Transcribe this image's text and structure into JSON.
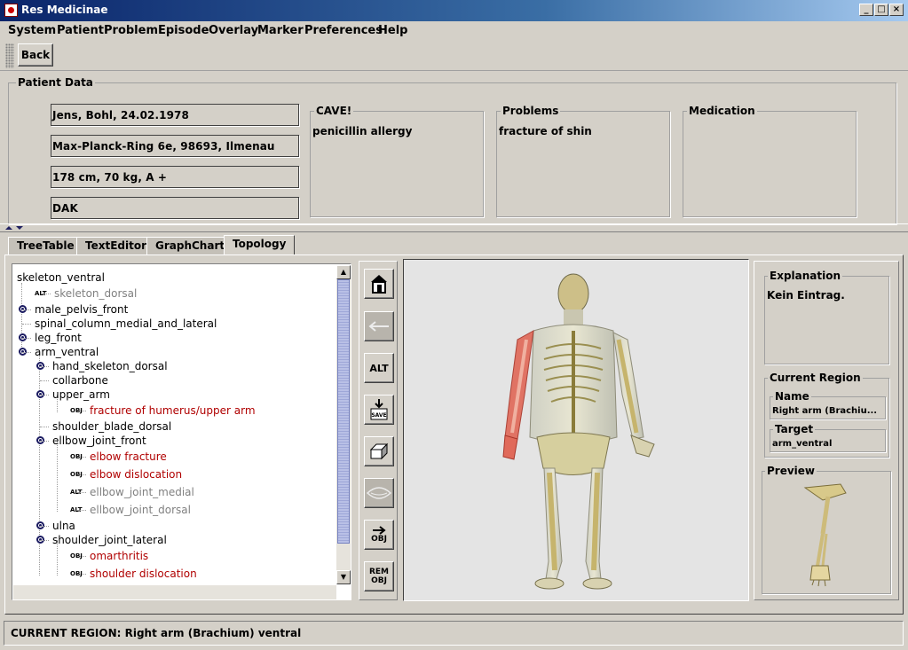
{
  "window": {
    "title": "Res Medicinae",
    "min": "_",
    "max": "□",
    "close": "×"
  },
  "menu": [
    "System",
    "Patient",
    "Problem",
    "Episode",
    "Overlay",
    "Marker",
    "Preferences",
    "Help"
  ],
  "toolbar": {
    "back_label": "Back"
  },
  "patient": {
    "group_title": "Patient Data",
    "fields": [
      "Jens, Bohl, 24.02.1978",
      "Max-Planck-Ring 6e, 98693, Ilmenau",
      "178 cm, 70 kg, A +",
      "DAK"
    ],
    "cave": {
      "title": "CAVE!",
      "text": "penicillin allergy"
    },
    "problems": {
      "title": "Problems",
      "text": "fracture of shin"
    },
    "medication": {
      "title": "Medication",
      "text": ""
    }
  },
  "tabs": [
    "TreeTable",
    "TextEditor",
    "GraphChart",
    "Topology"
  ],
  "active_tab": "Topology",
  "tree": [
    {
      "text": "skeleton_ventral",
      "kind": "node"
    },
    {
      "text": "skeleton_dorsal",
      "kind": "alt",
      "tag": "ALT"
    },
    {
      "text": "male_pelvis_front",
      "kind": "node"
    },
    {
      "text": "spinal_column_medial_and_lateral",
      "kind": "node"
    },
    {
      "text": "leg_front",
      "kind": "node"
    },
    {
      "text": "arm_ventral",
      "kind": "node"
    },
    {
      "text": "hand_skeleton_dorsal",
      "kind": "node"
    },
    {
      "text": "collarbone",
      "kind": "node"
    },
    {
      "text": "upper_arm",
      "kind": "node"
    },
    {
      "text": "fracture of humerus/upper arm",
      "kind": "obj",
      "tag": "OBJ"
    },
    {
      "text": "shoulder_blade_dorsal",
      "kind": "node"
    },
    {
      "text": "ellbow_joint_front",
      "kind": "node"
    },
    {
      "text": "elbow fracture",
      "kind": "obj",
      "tag": "OBJ"
    },
    {
      "text": "elbow dislocation",
      "kind": "obj",
      "tag": "OBJ"
    },
    {
      "text": "ellbow_joint_medial",
      "kind": "alt",
      "tag": "ALT"
    },
    {
      "text": "ellbow_joint_dorsal",
      "kind": "alt",
      "tag": "ALT"
    },
    {
      "text": "ulna",
      "kind": "node"
    },
    {
      "text": "shoulder_joint_lateral",
      "kind": "node"
    },
    {
      "text": "omarthritis",
      "kind": "obj",
      "tag": "OBJ"
    },
    {
      "text": "shoulder dislocation",
      "kind": "obj",
      "tag": "OBJ"
    }
  ],
  "tools": {
    "alt": "ALT",
    "save": "SAVE",
    "obj": "OBJ",
    "rem": "REM",
    "rem_obj": "OBJ"
  },
  "right": {
    "explanation_title": "Explanation",
    "explanation_text": "Kein Eintrag.",
    "region_title": "Current Region",
    "name_title": "Name",
    "name_value": "Right arm (Brachiu...",
    "target_title": "Target",
    "target_value": "arm_ventral",
    "preview_title": "Preview"
  },
  "status": "CURRENT REGION: Right arm (Brachium) ventral",
  "colors": {
    "obj": "#b00000",
    "alt": "#808080",
    "highlight_region": "#e06a5a",
    "titlebar": "#0a246a"
  }
}
